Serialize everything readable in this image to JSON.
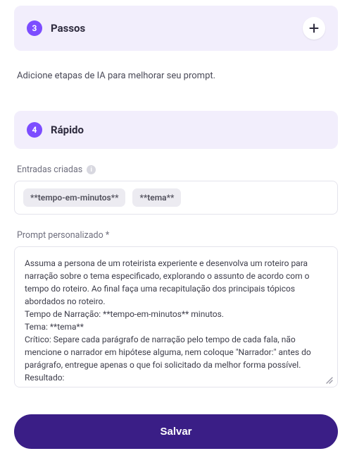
{
  "sections": {
    "passos": {
      "number": "3",
      "title": "Passos"
    },
    "rapido": {
      "number": "4",
      "title": "Rápido"
    }
  },
  "info_text": "Adicione etapas de IA para melhorar seu prompt.",
  "entries": {
    "label": "Entradas criadas",
    "pills": [
      "**tempo-em-minutos**",
      "**tema**"
    ]
  },
  "prompt": {
    "label": "Prompt personalizado *",
    "value": "Assuma a persona de um roteirista experiente e desenvolva um roteiro para narração sobre o tema especificado, explorando o assunto de acordo com o tempo do roteiro. Ao final faça uma recapitulação dos principais tópicos abordados no roteiro.\nTempo de Narração: **tempo-em-minutos** minutos.\nTema: **tema**\nCrítico: Separe cada parágrafo de narração pelo tempo de cada fala, não mencione o narrador em hipótese alguma, nem coloque \"Narrador:\" antes do parágrafo, entregue apenas o que foi solicitado da melhor forma possível.\nResultado:"
  },
  "save_label": "Salvar"
}
